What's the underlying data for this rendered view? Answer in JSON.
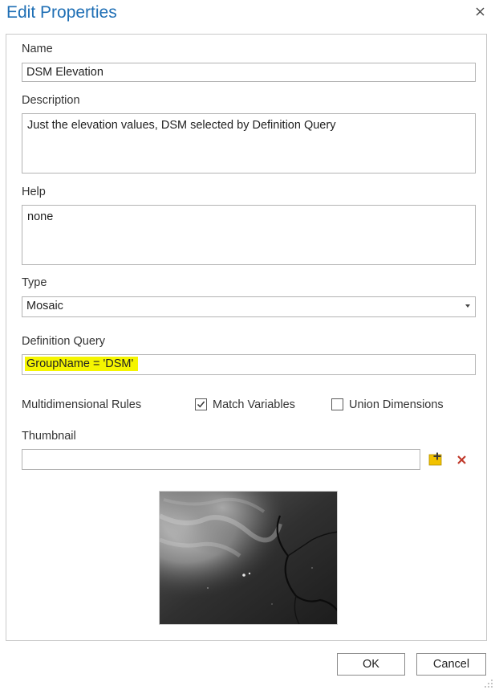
{
  "dialog": {
    "title": "Edit Properties"
  },
  "form": {
    "name_label": "Name",
    "name_value": "DSM Elevation",
    "description_label": "Description",
    "description_value": "Just the elevation values, DSM selected by Definition Query",
    "help_label": "Help",
    "help_value": "none",
    "type_label": "Type",
    "type_value": "Mosaic",
    "definition_query_label": "Definition Query",
    "definition_query_value": "GroupName = 'DSM'",
    "multidimensional_label": "Multidimensional Rules",
    "match_variables_label": "Match Variables",
    "match_variables_checked": true,
    "union_dimensions_label": "Union Dimensions",
    "union_dimensions_checked": false,
    "thumbnail_label": "Thumbnail",
    "thumbnail_value": ""
  },
  "buttons": {
    "ok_label": "OK",
    "cancel_label": "Cancel"
  },
  "icons": {
    "close": "close-icon",
    "add_thumbnail": "add-image-icon",
    "remove_thumbnail": "delete-x-icon",
    "dropdown": "chevron-down-icon"
  },
  "colors": {
    "title": "#1f6fb5",
    "highlight": "#f5f500",
    "delete": "#c0392b",
    "add_icon": "#f2c200"
  }
}
